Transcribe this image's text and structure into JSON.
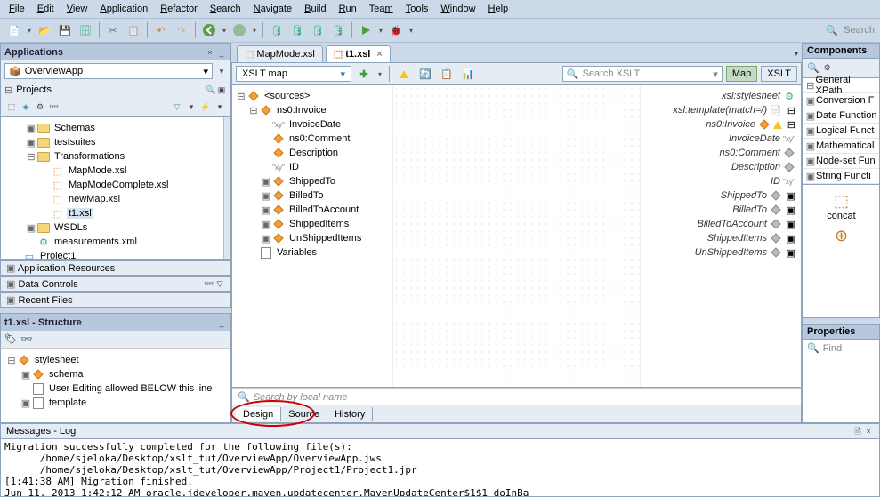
{
  "menu": [
    "File",
    "Edit",
    "View",
    "Application",
    "Refactor",
    "Search",
    "Navigate",
    "Build",
    "Run",
    "Team",
    "Tools",
    "Window",
    "Help"
  ],
  "mainSearch": "Search",
  "left": {
    "applications_title": "Applications",
    "app_name": "OverviewApp",
    "projects_label": "Projects",
    "tree": [
      {
        "indent": 0,
        "exp": "▣",
        "type": "folder",
        "label": "Schemas"
      },
      {
        "indent": 0,
        "exp": "▣",
        "type": "folder",
        "label": "testsuites"
      },
      {
        "indent": 0,
        "exp": "⊟",
        "type": "folder",
        "label": "Transformations"
      },
      {
        "indent": 1,
        "exp": "",
        "type": "xsl",
        "label": "MapMode.xsl"
      },
      {
        "indent": 1,
        "exp": "",
        "type": "xsl",
        "label": "MapModeComplete.xsl"
      },
      {
        "indent": 1,
        "exp": "",
        "type": "xsl",
        "label": "newMap.xsl"
      },
      {
        "indent": 1,
        "exp": "",
        "type": "xsl",
        "label": "t1.xsl",
        "selected": true
      },
      {
        "indent": 0,
        "exp": "▣",
        "type": "folder",
        "label": "WSDLs"
      },
      {
        "indent": 0,
        "exp": "",
        "type": "xml",
        "label": "measurements.xml"
      },
      {
        "indent": -1,
        "exp": "",
        "type": "proj",
        "label": "Project1"
      }
    ],
    "stacked": {
      "app_resources": "Application Resources",
      "data_controls": "Data Controls",
      "recent": "Recent Files"
    },
    "structure": {
      "title": "t1.xsl - Structure",
      "items": [
        {
          "indent": 0,
          "exp": "⊟",
          "icon": "diamond",
          "label": "stylesheet"
        },
        {
          "indent": 1,
          "exp": "▣",
          "icon": "diamond",
          "label": "schema"
        },
        {
          "indent": 1,
          "exp": "",
          "icon": "file",
          "label": "User Editing allowed BELOW this line"
        },
        {
          "indent": 1,
          "exp": "▣",
          "icon": "file",
          "label": "template"
        }
      ]
    }
  },
  "center": {
    "tabs": [
      {
        "label": "MapMode.xsl",
        "active": false
      },
      {
        "label": "t1.xsl",
        "active": true
      }
    ],
    "xslt_map_label": "XSLT map",
    "search_placeholder": "Search XSLT",
    "map_btn": "Map",
    "xslt_btn": "XSLT",
    "source_tree": [
      {
        "exp": "⊟",
        "icon": "anchor",
        "label": "<sources>"
      },
      {
        "indent": 1,
        "exp": "⊟",
        "icon": "diamond",
        "label": "ns0:Invoice"
      },
      {
        "indent": 2,
        "exp": "",
        "icon": "field",
        "label": "InvoiceDate",
        "prefix": "\"xy\""
      },
      {
        "indent": 2,
        "exp": "",
        "icon": "diamond",
        "label": "ns0:Comment"
      },
      {
        "indent": 2,
        "exp": "",
        "icon": "diamond",
        "label": "Description"
      },
      {
        "indent": 2,
        "exp": "",
        "icon": "field",
        "label": "ID",
        "prefix": "\"xy\""
      },
      {
        "indent": 2,
        "exp": "▣",
        "icon": "diamond",
        "label": "ShippedTo"
      },
      {
        "indent": 2,
        "exp": "▣",
        "icon": "diamond",
        "label": "BilledTo"
      },
      {
        "indent": 2,
        "exp": "▣",
        "icon": "diamond",
        "label": "BilledToAccount"
      },
      {
        "indent": 2,
        "exp": "▣",
        "icon": "diamond",
        "label": "ShippedItems"
      },
      {
        "indent": 2,
        "exp": "▣",
        "icon": "diamond",
        "label": "UnShippedItems"
      },
      {
        "indent": 1,
        "exp": "",
        "icon": "file",
        "label": "Variables"
      }
    ],
    "target_tree": [
      {
        "label": "xsl:stylesheet",
        "icon": "gear"
      },
      {
        "label": "xsl:template(match=/)",
        "icon": "file",
        "exp": "⊟"
      },
      {
        "label": "ns0:Invoice",
        "icon": "diamond",
        "warn": true,
        "exp": "⊟"
      },
      {
        "label": "InvoiceDate",
        "icon": "field",
        "grey": true
      },
      {
        "label": "ns0:Comment",
        "icon": "diamond",
        "grey": true
      },
      {
        "label": "Description",
        "icon": "diamond",
        "grey": true
      },
      {
        "label": "ID",
        "icon": "field",
        "grey": true
      },
      {
        "label": "ShippedTo",
        "icon": "diamond",
        "grey": true,
        "exp": "▣"
      },
      {
        "label": "BilledTo",
        "icon": "diamond",
        "grey": true,
        "exp": "▣"
      },
      {
        "label": "BilledToAccount",
        "icon": "diamond",
        "grey": true,
        "exp": "▣"
      },
      {
        "label": "ShippedItems",
        "icon": "diamond",
        "grey": true,
        "exp": "▣"
      },
      {
        "label": "UnShippedItems",
        "icon": "diamond",
        "grey": true,
        "exp": "▣"
      }
    ],
    "local_search": "Search by local name",
    "bottom_tabs": [
      "Design",
      "Source",
      "History"
    ]
  },
  "right": {
    "components": "Components",
    "general_xpath": "General XPath",
    "categories": [
      "General XPath",
      "Conversion F",
      "Date Function",
      "Logical Funct",
      "Mathematical",
      "Node-set Fun",
      "String Functi"
    ],
    "concat": "concat"
  },
  "messages": {
    "title": "Messages - Log",
    "lines": [
      "Migration successfully completed for the following file(s):",
      "      /home/sjeloka/Desktop/xslt_tut/OverviewApp/OverviewApp.jws",
      "      /home/sjeloka/Desktop/xslt_tut/OverviewApp/Project1/Project1.jpr",
      "[1:41:38 AM] Migration finished.",
      "Jun 11, 2013 1:42:12 AM oracle.jdeveloper.maven.updatecenter.MavenUpdateCenter$1$1 doInBa"
    ]
  },
  "properties": {
    "title": "Properties",
    "find": "Find"
  }
}
